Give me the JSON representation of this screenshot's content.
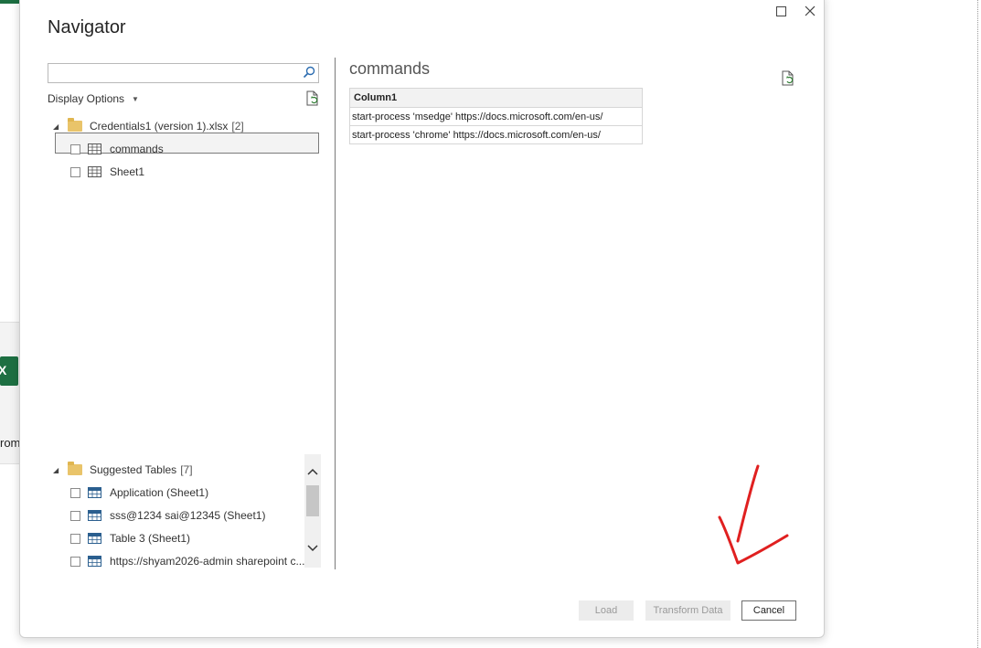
{
  "background": {
    "excel_letter": "X",
    "partial_label": "rom"
  },
  "dialog": {
    "title": "Navigator",
    "search": {
      "value": "",
      "placeholder": ""
    },
    "display_options_label": "Display Options",
    "tree": {
      "root": {
        "label": "Credentials1 (version 1).xlsx",
        "count": "[2]"
      },
      "items": [
        {
          "label": "commands",
          "checked": false,
          "selected": true
        },
        {
          "label": "Sheet1",
          "checked": false,
          "selected": false
        }
      ]
    },
    "suggested": {
      "label": "Suggested Tables",
      "count": "[7]",
      "items": [
        {
          "label": "Application (Sheet1)"
        },
        {
          "label": "sss@1234 sai@12345 (Sheet1)"
        },
        {
          "label": "Table 3 (Sheet1)"
        },
        {
          "label": "https://shyam2026-admin sharepoint c..."
        }
      ]
    },
    "preview": {
      "title": "commands",
      "columns": [
        "Column1"
      ],
      "rows": [
        [
          "start-process 'msedge' https://docs.microsoft.com/en-us/"
        ],
        [
          "start-process 'chrome' https://docs.microsoft.com/en-us/"
        ]
      ]
    },
    "buttons": {
      "load": "Load",
      "transform": "Transform Data",
      "cancel": "Cancel"
    }
  },
  "colors": {
    "annotation_arrow": "#e02020",
    "folder": "#e9c46a",
    "excel_green": "#1d6f42"
  }
}
